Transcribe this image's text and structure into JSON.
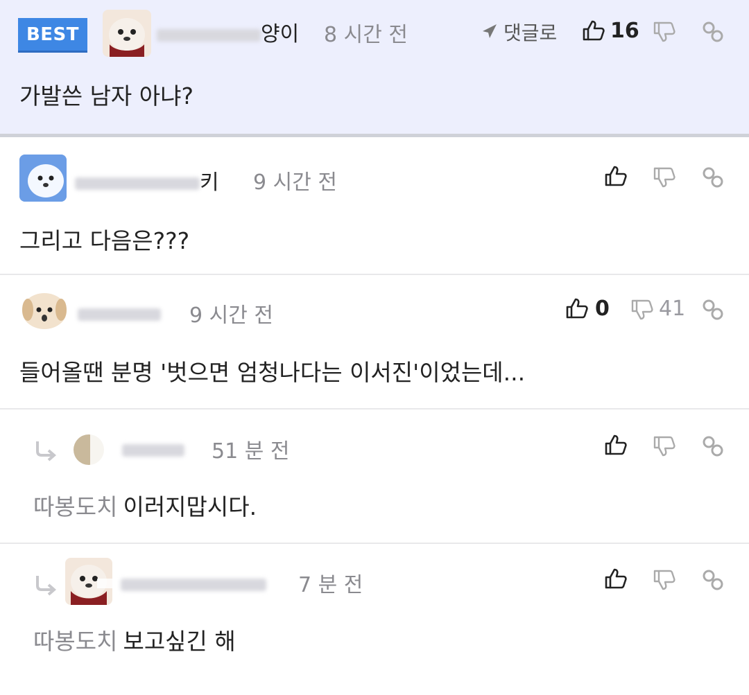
{
  "comments": [
    {
      "badge": "BEST",
      "name_tail": "양이",
      "time": "8 시간 전",
      "reply_label": "댓글로",
      "likes": "16",
      "text": "가발쓴 남자 아냐?"
    },
    {
      "name_tail": "키",
      "time": "9 시간 전",
      "text": "그리고 다음은???"
    },
    {
      "time": "9 시간 전",
      "likes": "0",
      "dislikes": "41",
      "text": "들어올땐 분명 '벗으면 엄청나다는 이서진'이었는데..."
    },
    {
      "time": "51 분 전",
      "mention": "따봉도치",
      "text": "이러지맙시다."
    },
    {
      "time": "7 분 전",
      "mention": "따봉도치",
      "text": "보고싶긴 해"
    }
  ],
  "icons": {
    "like": "thumbs-up-icon",
    "dislike": "thumbs-down-icon",
    "link": "link-icon",
    "reply": "reply-arrow-icon",
    "share": "send-arrow-icon"
  },
  "colors": {
    "best_bg": "#edeffd",
    "badge": "#3e87e4",
    "muted": "#8a8a8f"
  }
}
